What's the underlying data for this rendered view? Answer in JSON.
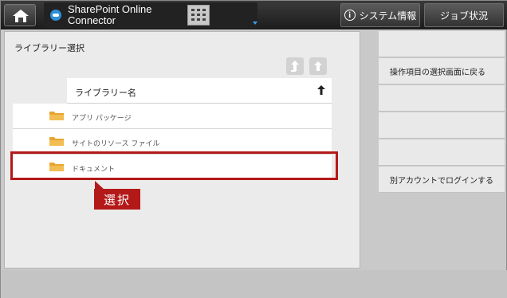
{
  "topbar": {
    "app_title_line1": "SharePoint Online",
    "app_title_line2": "Connector",
    "sysinfo_label": "システム情報",
    "info_glyph": "i",
    "job_label": "ジョブ状況"
  },
  "panel": {
    "title": "ライブラリー選択",
    "column_header": "ライブラリー名",
    "items": [
      {
        "label": "アプリ パッケージ"
      },
      {
        "label": "サイトのリソース ファイル"
      },
      {
        "label": "ドキュメント"
      }
    ],
    "callout": "選択"
  },
  "right_menu": {
    "items": [
      {
        "label": ""
      },
      {
        "label": "操作項目の選択画面に戻る"
      },
      {
        "label": ""
      },
      {
        "label": ""
      },
      {
        "label": ""
      },
      {
        "label": "別アカウントでログインする"
      }
    ]
  },
  "colors": {
    "highlight": "#b41919",
    "folder": "#e8a530",
    "cloud": "#2d8fd8"
  },
  "icons": {
    "home": "home-icon",
    "cloud": "cloud-icon",
    "keypad": "keypad-icon",
    "info": "info-icon",
    "folder": "folder-icon",
    "up": "up-arrow-icon",
    "sort": "sort-up-icon"
  }
}
